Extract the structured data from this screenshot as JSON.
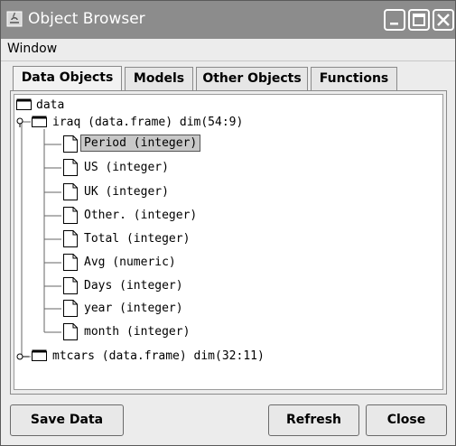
{
  "title": "Object Browser",
  "menu": [
    "Window"
  ],
  "tabs": [
    "Data Objects",
    "Models",
    "Other Objects",
    "Functions"
  ],
  "tree": {
    "root": "data",
    "iraq": "iraq (data.frame) dim(54:9)",
    "children": [
      "Period (integer)",
      "US (integer)",
      "UK (integer)",
      "Other. (integer)",
      "Total (integer)",
      "Avg (numeric)",
      "Days (integer)",
      "year (integer)",
      "month (integer)"
    ],
    "mtcars": "mtcars (data.frame) dim(32:11)"
  },
  "buttons": {
    "save": "Save Data",
    "refresh": "Refresh",
    "close": "Close"
  },
  "colors": {
    "titlebar": "#8c8c8c",
    "selected": "#c8c8c8"
  }
}
